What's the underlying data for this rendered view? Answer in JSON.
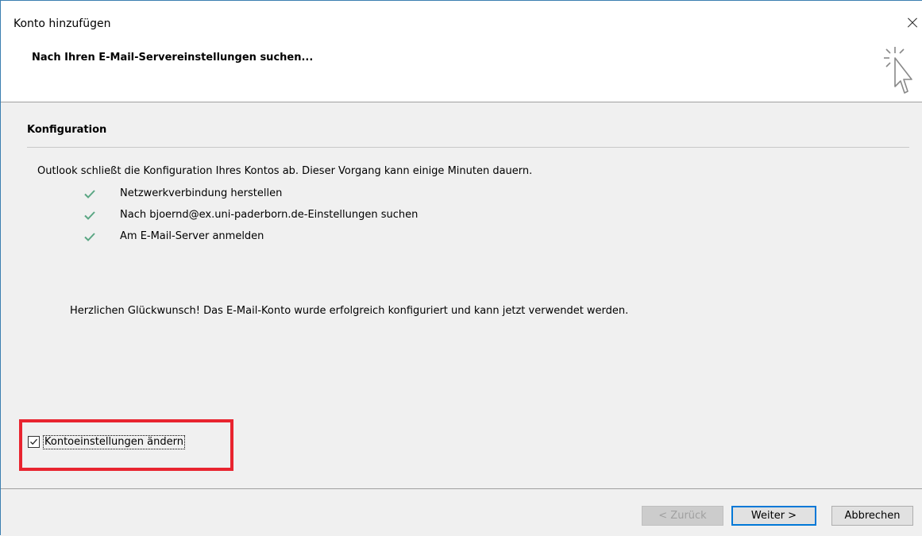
{
  "window": {
    "title": "Konto hinzufügen"
  },
  "header": {
    "heading": "Nach Ihren E-Mail-Servereinstellungen suchen..."
  },
  "configuration": {
    "section_title": "Konfiguration",
    "intro": "Outlook schließt die Konfiguration Ihres Kontos ab. Dieser Vorgang kann einige Minuten dauern.",
    "steps": [
      {
        "label": "Netzwerkverbindung herstellen",
        "status": "done"
      },
      {
        "label": "Nach bjoernd@ex.uni-paderborn.de-Einstellungen suchen",
        "status": "done"
      },
      {
        "label": "Am E-Mail-Server anmelden",
        "status": "done"
      }
    ],
    "success_message": "Herzlichen Glückwunsch! Das E-Mail-Konto wurde erfolgreich konfiguriert und kann jetzt verwendet werden."
  },
  "options": {
    "change_settings_label": "Kontoeinstellungen ändern",
    "change_settings_checked": true
  },
  "footer": {
    "back_label": "< Zurück",
    "next_label": "Weiter >",
    "cancel_label": "Abbrechen"
  },
  "colors": {
    "check": "#5aa683",
    "highlight": "#e8242f",
    "accent": "#0078d7"
  }
}
